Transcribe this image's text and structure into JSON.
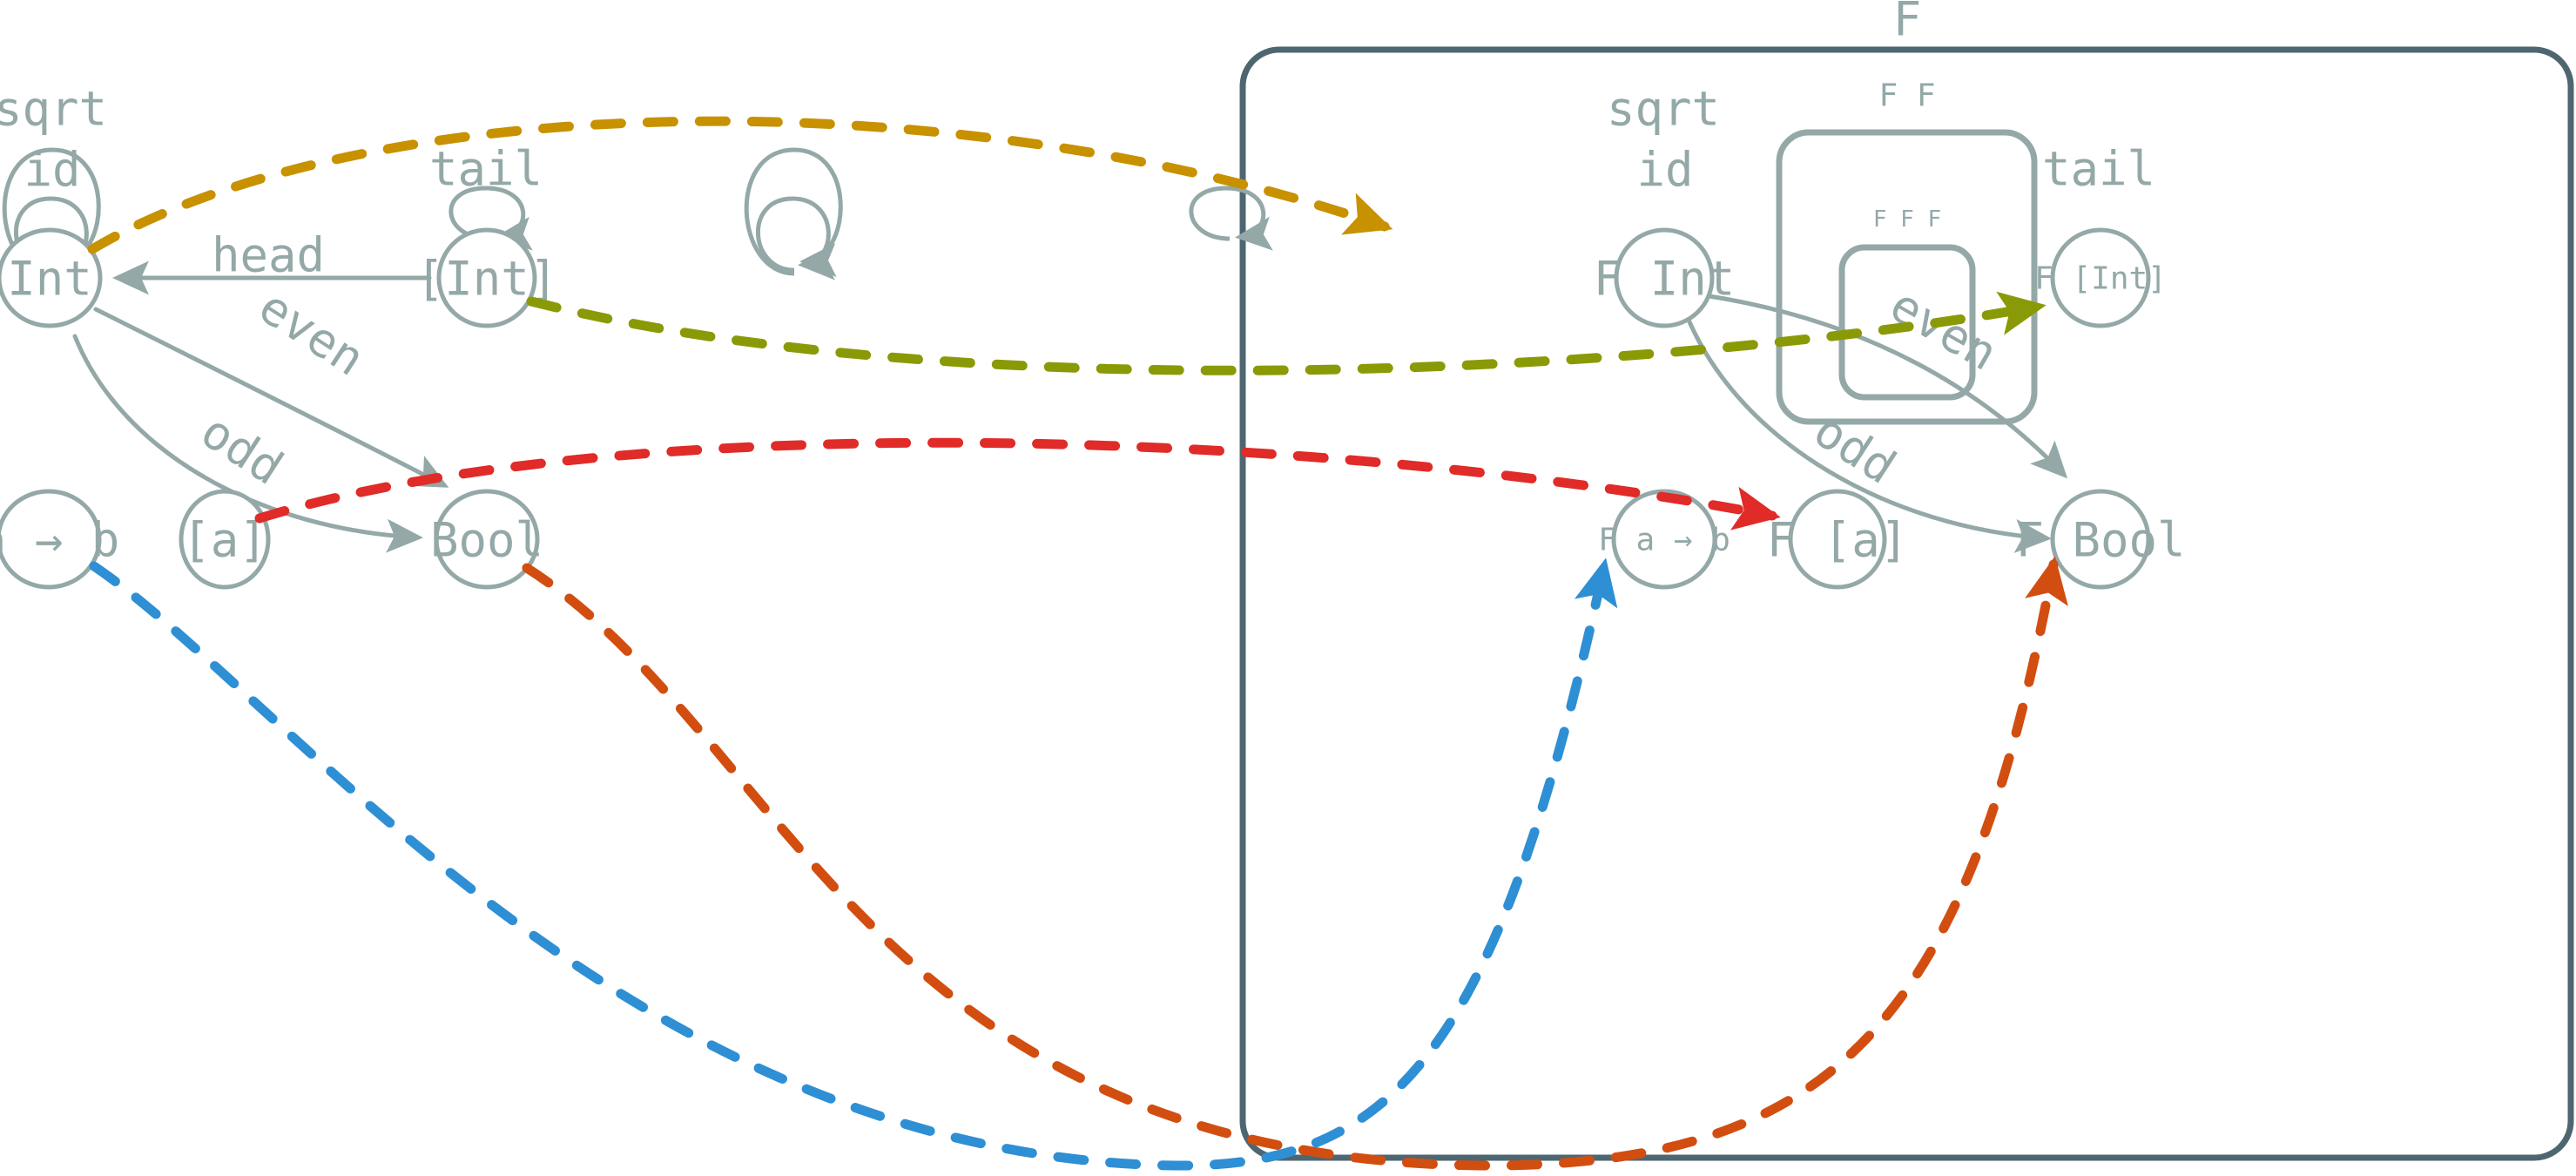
{
  "diagram": {
    "title_label": "F",
    "nested_boxes": [
      {
        "label": "F F"
      },
      {
        "label": "F F F"
      }
    ],
    "source_category": {
      "nodes": [
        {
          "id": "Int",
          "label": "Int"
        },
        {
          "id": "ListInt",
          "label": "[Int]"
        },
        {
          "id": "Bool",
          "label": "Bool"
        },
        {
          "id": "Arrow",
          "label": "a → b"
        },
        {
          "id": "ListA",
          "label": "[a]"
        }
      ],
      "self_loops": [
        {
          "on": "Int",
          "label": "id"
        },
        {
          "on": "Int",
          "label": "sqrt"
        },
        {
          "on": "ListInt",
          "label": "tail"
        }
      ],
      "edges": [
        {
          "from": "ListInt",
          "to": "Int",
          "label": "head"
        },
        {
          "from": "Int",
          "to": "Bool",
          "label": "even"
        },
        {
          "from": "Int",
          "to": "Bool",
          "label": "odd"
        }
      ]
    },
    "target_category": {
      "nodes": [
        {
          "id": "FInt",
          "label": "F Int"
        },
        {
          "id": "FListInt",
          "label": "F [Int]"
        },
        {
          "id": "FBool",
          "label": "F Bool"
        },
        {
          "id": "FArrow",
          "label": "F a → b"
        },
        {
          "id": "FListA",
          "label": "F [a]"
        }
      ],
      "self_loops": [
        {
          "on": "FInt",
          "label": "id"
        },
        {
          "on": "FInt",
          "label": "sqrt"
        },
        {
          "on": "FListInt",
          "label": "tail"
        }
      ],
      "edges": [
        {
          "from": "FInt",
          "to": "FListInt",
          "label": "even"
        },
        {
          "from": "FInt",
          "to": "FBool",
          "label": "odd"
        }
      ]
    },
    "functor_mappings": [
      {
        "from": "Int",
        "to": "FInt",
        "color": "#c79100"
      },
      {
        "from": "ListInt",
        "to": "FListInt",
        "color": "#8a9a06"
      },
      {
        "from": "ListA",
        "to": "FListA",
        "color": "#e02b28"
      },
      {
        "from": "Bool",
        "to": "FBool",
        "color": "#d24e10"
      },
      {
        "from": "Arrow",
        "to": "FArrow",
        "color": "#2e8fd4"
      }
    ],
    "colors": {
      "node_stroke": "#94a8a8",
      "text": "#94a8a8",
      "container_stroke": "#4e6670",
      "background": "#ffffff",
      "map_int": "#c79100",
      "map_listint": "#8a9a06",
      "map_lista": "#e02b28",
      "map_bool": "#d24e10",
      "map_arrow": "#2e8fd4"
    }
  }
}
